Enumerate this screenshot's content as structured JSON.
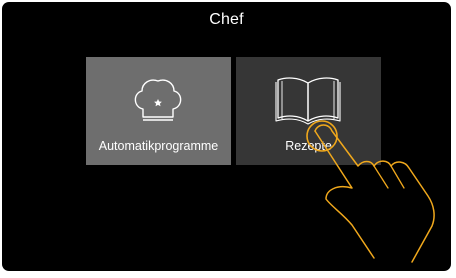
{
  "header": {
    "title": "Chef"
  },
  "tiles": [
    {
      "label": "Automatikprogramme",
      "icon": "chef-hat-icon"
    },
    {
      "label": "Rezepte",
      "icon": "open-book-icon",
      "touched": true
    }
  ],
  "colors": {
    "background": "#000000",
    "tile_selected": "#6e6e6e",
    "tile_default": "#363636",
    "text": "#ffffff",
    "touch_accent": "#f0a81c"
  }
}
